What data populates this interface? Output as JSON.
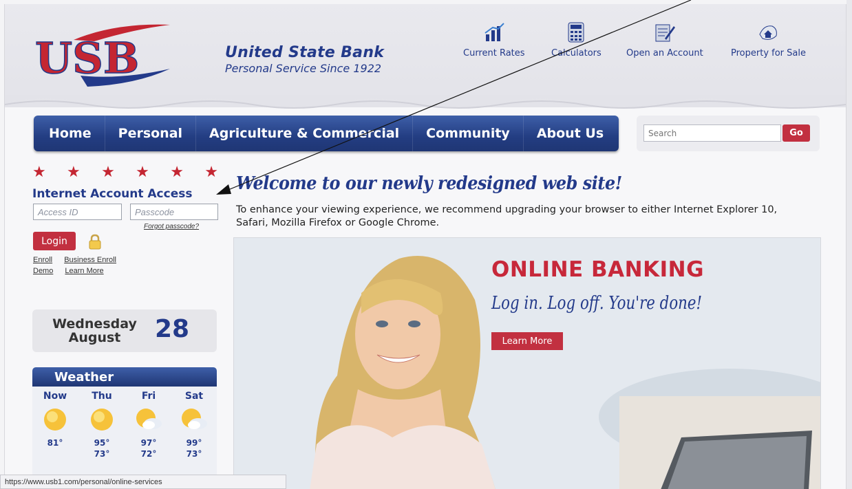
{
  "header": {
    "bank_name": "United State Bank",
    "tagline": "Personal Service Since 1922",
    "logo_text": "USB",
    "quick_links": [
      "Current Rates",
      "Calculators",
      "Open an Account",
      "Property for Sale"
    ]
  },
  "nav": {
    "items": [
      "Home",
      "Personal",
      "Agriculture & Commercial",
      "Community",
      "About Us"
    ],
    "search_placeholder": "Search",
    "go_label": "Go"
  },
  "login_panel": {
    "title": "Internet Account Access",
    "access_id_placeholder": "Access ID",
    "passcode_placeholder": "Passcode",
    "forgot_label": "Forgot passcode?",
    "login_label": "Login",
    "links_row1": [
      "Enroll",
      "Business Enroll"
    ],
    "links_row2": [
      "Demo",
      "Learn More"
    ]
  },
  "date": {
    "weekday": "Wednesday",
    "month": "August",
    "day": "28"
  },
  "weather": {
    "title": "Weather",
    "days": [
      {
        "label": "Now",
        "high": "81°",
        "low": ""
      },
      {
        "label": "Thu",
        "high": "95°",
        "low": "73°"
      },
      {
        "label": "Fri",
        "high": "97°",
        "low": "72°"
      },
      {
        "label": "Sat",
        "high": "99°",
        "low": "73°"
      }
    ]
  },
  "main": {
    "welcome": "Welcome to our newly redesigned web site!",
    "intro": "To enhance your viewing experience, we recommend upgrading your browser to either Internet Explorer 10, Safari, Mozilla Firefox or Google Chrome.",
    "hero_title": "ONLINE BANKING",
    "hero_sub": "Log in. Log off. You're done!",
    "hero_button": "Learn More"
  },
  "status_bar": "https://www.usb1.com/personal/online-services",
  "colors": {
    "brand_blue": "#233a8a",
    "brand_red": "#c23040"
  }
}
